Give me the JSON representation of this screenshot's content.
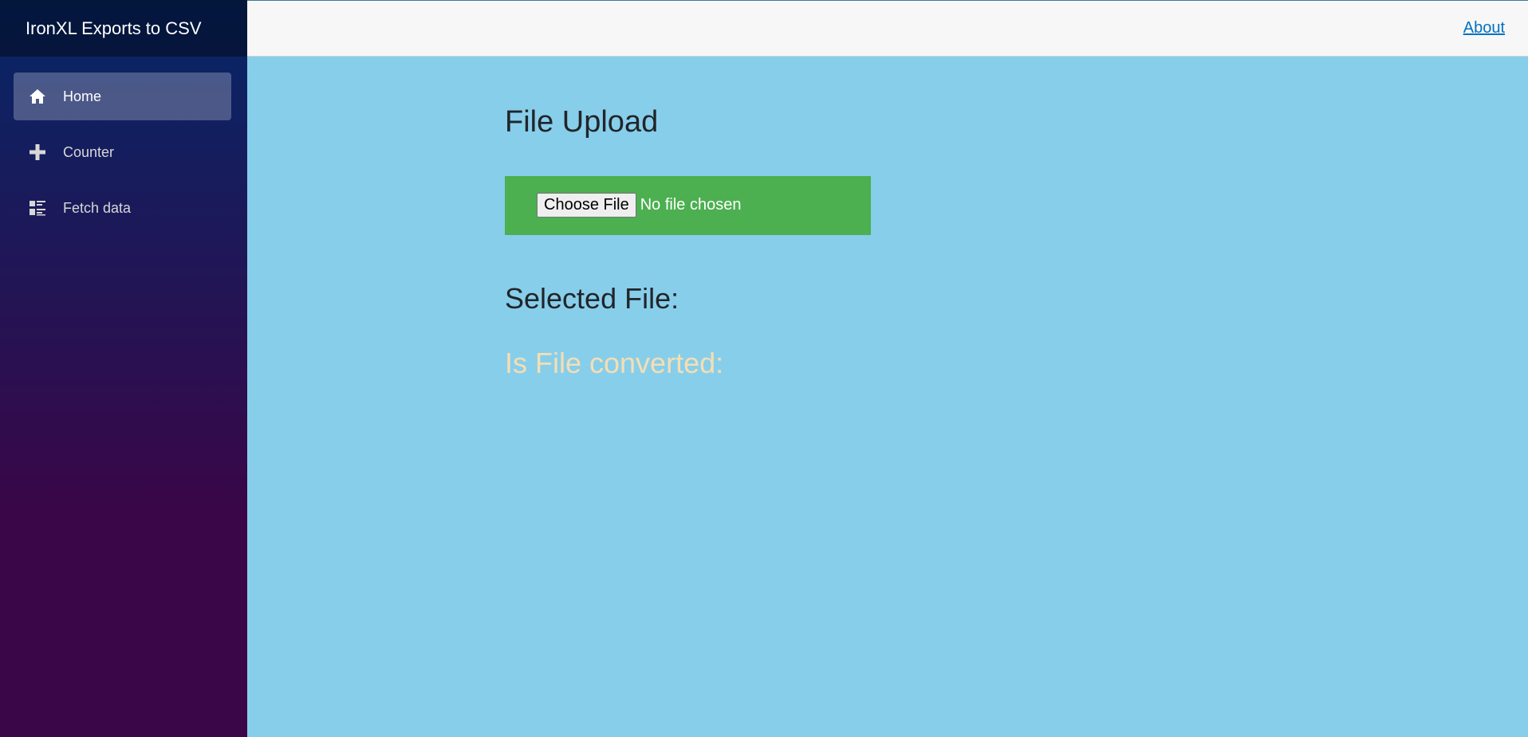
{
  "sidebar": {
    "brand": "IronXL Exports to CSV",
    "items": [
      {
        "label": "Home",
        "icon": "home-icon",
        "active": true
      },
      {
        "label": "Counter",
        "icon": "plus-icon",
        "active": false
      },
      {
        "label": "Fetch data",
        "icon": "list-icon",
        "active": false
      }
    ]
  },
  "header": {
    "about_label": "About"
  },
  "main": {
    "title": "File Upload",
    "upload": {
      "button_label": "Choose File",
      "status": "No file chosen"
    },
    "selected_file_label": "Selected File:",
    "converted_label": "Is File converted:"
  },
  "colors": {
    "content_bg": "#87ceeb",
    "upload_bg": "#4caf50",
    "converted_text": "#f5deb3",
    "link": "#0071c1"
  }
}
